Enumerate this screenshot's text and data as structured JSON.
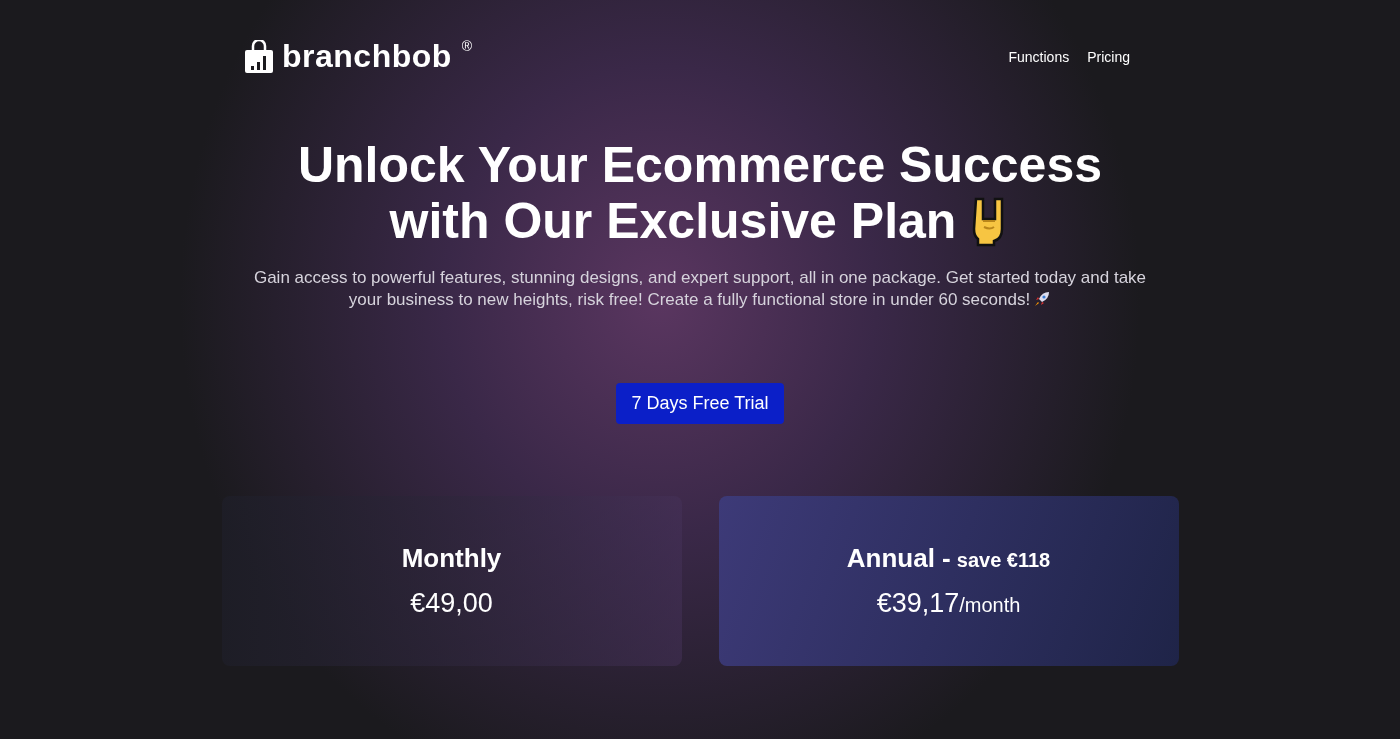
{
  "brand": {
    "name": "branchbob",
    "mark": "®"
  },
  "nav": [
    {
      "label": "Functions"
    },
    {
      "label": "Pricing"
    }
  ],
  "hero": {
    "title_lines": [
      "Unlock Your Ecommerce Success",
      "with Our Exclusive Plan"
    ],
    "subtitle": "Gain access to powerful features, stunning designs, and expert support, all in one package. Get started today and take your business to new heights, risk free! Create a fully functional store in under 60 seconds!",
    "cta": "7 Days Free Trial"
  },
  "plans": [
    {
      "name": "Monthly",
      "price": "€49,00",
      "selected": false
    },
    {
      "name": "Annual -",
      "saving": "save €118",
      "price": "€39,17",
      "period": "/month",
      "selected": true
    }
  ]
}
